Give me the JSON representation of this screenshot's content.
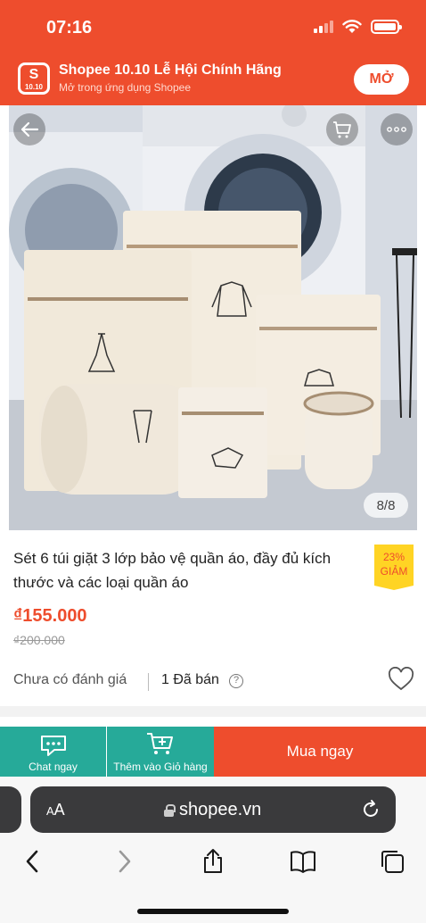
{
  "status_bar": {
    "time": "07:16"
  },
  "banner": {
    "logo_letter": "S",
    "logo_text": "10.10",
    "title": "Shopee 10.10 Lễ Hội Chính Hãng",
    "subtitle": "Mở trong ứng dụng Shopee",
    "open_label": "MỞ"
  },
  "gallery": {
    "counter": "8/8"
  },
  "product": {
    "title": "Sét 6 túi giặt 3 lớp bảo vệ quần áo, đầy đủ kích thước và các loại quần áo",
    "discount_percent": "23%",
    "discount_word": "GIẢM",
    "price": "₫155.000",
    "old_price": "₫200.000",
    "rating_text": "Chưa có đánh giá",
    "sold_text": "1 Đã bán",
    "help_symbol": "?"
  },
  "action_bar": {
    "chat_label": "Chat ngay",
    "cart_label": "Thêm vào Giỏ hàng",
    "buy_label": "Mua ngay"
  },
  "browser": {
    "aa_small": "A",
    "aa_big": "A",
    "url": "shopee.vn"
  },
  "colors": {
    "brand": "#ee4d2d",
    "teal": "#26aa99",
    "badge": "#ffd424"
  },
  "icons": [
    "back-arrow-icon",
    "cart-icon",
    "more-icon",
    "heart-icon",
    "chat-icon",
    "add-to-cart-icon",
    "lock-icon",
    "reload-icon",
    "chevron-left-icon",
    "chevron-right-icon",
    "share-icon",
    "bookmarks-icon",
    "tabs-icon"
  ]
}
